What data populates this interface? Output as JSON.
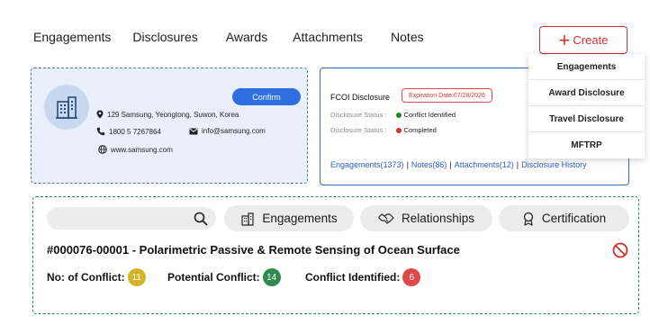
{
  "nav": {
    "tabs": [
      {
        "label": "Engagements"
      },
      {
        "label": "Disclosures"
      },
      {
        "label": "Awards"
      },
      {
        "label": "Attachments"
      },
      {
        "label": "Notes"
      }
    ],
    "create_label": "Create",
    "create_menu": [
      {
        "label": "Engagements"
      },
      {
        "label": "Award Disclosure"
      },
      {
        "label": "Travel Disclosure"
      },
      {
        "label": "MFTRP"
      }
    ]
  },
  "company": {
    "confirm_label": "Confirm",
    "address": "129 Samsung, Yeongtong, Suwon, Korea",
    "phone": "1800 5 7267864",
    "email": "info@samsung.com",
    "website": "www.samsung.com",
    "icons": [
      "building-icon",
      "location-pin-icon",
      "phone-icon",
      "mail-icon",
      "globe-icon"
    ]
  },
  "fcoi": {
    "title": "FCOI Disclosure",
    "expiration": "Expiration Date:07/28/2026",
    "status_rows": [
      {
        "label": "Disclosure Status :",
        "value": "Conflict Identified",
        "color": "#2e7d32"
      },
      {
        "label": "Disclosure Status :",
        "value": "Completed",
        "color": "#d32f2f"
      }
    ],
    "links": [
      {
        "label": "Engagements(1373)"
      },
      {
        "label": "Notes(86)"
      },
      {
        "label": "Attachments(12)"
      },
      {
        "label": "Disclosure History"
      }
    ]
  },
  "project": {
    "search": {
      "placeholder": "",
      "value": ""
    },
    "buttons": [
      {
        "label": "Engagements",
        "icon": "building-icon"
      },
      {
        "label": "Relationships",
        "icon": "handshake-icon"
      },
      {
        "label": "Certification",
        "icon": "ribbon-icon"
      }
    ],
    "title": "#000076-00001 - Polarimetric Passive & Remote Sensing of Ocean Surface",
    "conflicts": [
      {
        "label": "No: of Conflict:",
        "count": "11",
        "color": "#d4b52a"
      },
      {
        "label": "Potential Conflict:",
        "count": "14",
        "color": "#2e8b4a"
      },
      {
        "label": "Conflict Identified:",
        "count": "6",
        "color": "#e04848"
      }
    ]
  },
  "colors": {
    "accent_blue": "#2d6ee0",
    "create_red": "#d32f2f",
    "panel_green_border": "#2e8b57",
    "company_card_bg": "#eaf0fb"
  }
}
